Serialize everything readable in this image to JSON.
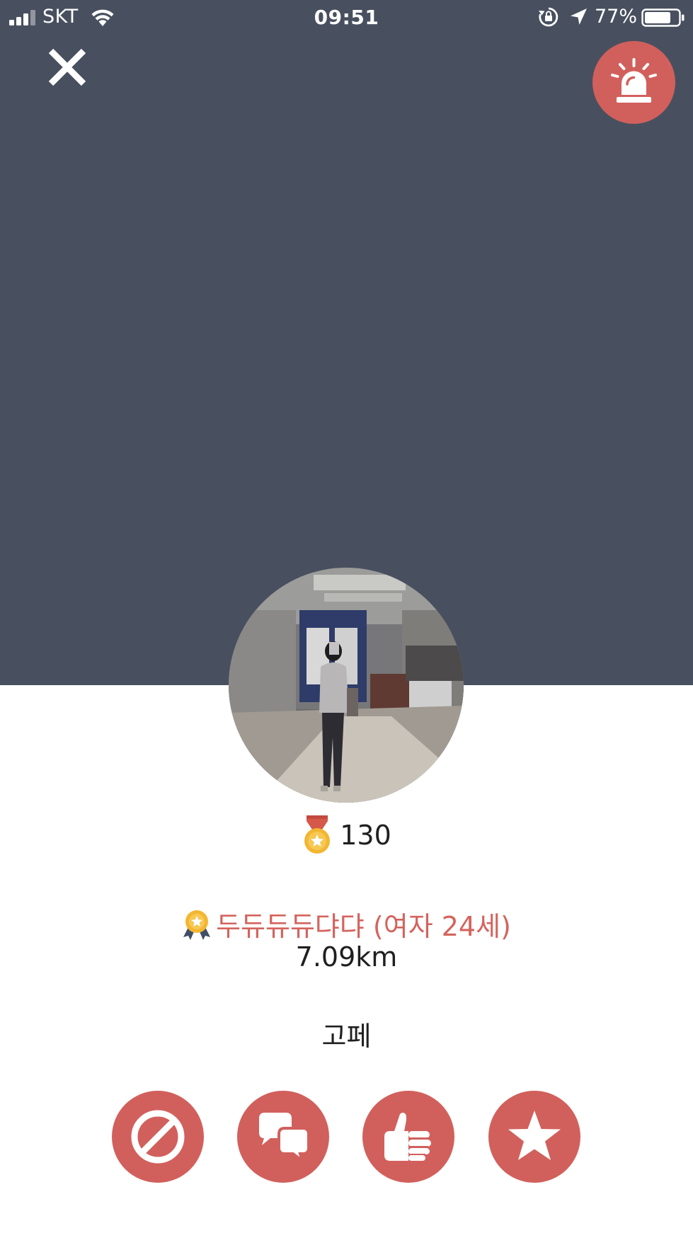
{
  "status_bar": {
    "carrier": "SKT",
    "time": "09:51",
    "battery_percent": "77%",
    "battery_level": 0.77,
    "signal_bars": 3,
    "icons": [
      "signal-icon",
      "wifi-icon",
      "rotation-lock-icon",
      "location-arrow-icon",
      "battery-icon"
    ]
  },
  "header": {
    "close_icon": "close-icon",
    "report_icon": "siren-icon"
  },
  "profile": {
    "score": "130",
    "name_line": "두듀듀듀댜댜 (여자 24세)",
    "distance": "7.09km",
    "status_message": "고페"
  },
  "actions": [
    {
      "icon": "block-icon"
    },
    {
      "icon": "chat-icon"
    },
    {
      "icon": "thumbs-up-icon"
    },
    {
      "icon": "star-icon"
    }
  ],
  "colors": {
    "header_bg": "#48505f",
    "accent": "#d1605c",
    "name_text": "#d4645e"
  }
}
